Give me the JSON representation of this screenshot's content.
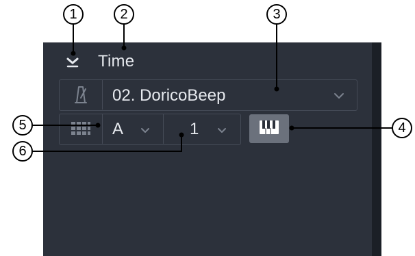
{
  "panel": {
    "title": "Time",
    "device_selector": {
      "value": "02. DoricoBeep",
      "icon": "metronome-icon"
    },
    "port_selector": {
      "value": "A",
      "icon": "grid-icon"
    },
    "channel_selector": {
      "value": "1"
    },
    "keyboard_button": {
      "icon": "piano-keyboard-icon"
    }
  },
  "callouts": [
    "1",
    "2",
    "3",
    "4",
    "5",
    "6"
  ],
  "colors": {
    "panel_bg": "#2c313b",
    "panel_edge": "#1b1f26",
    "border": "#454b57",
    "text": "#e6e9ee",
    "button_active": "#6b717c"
  }
}
